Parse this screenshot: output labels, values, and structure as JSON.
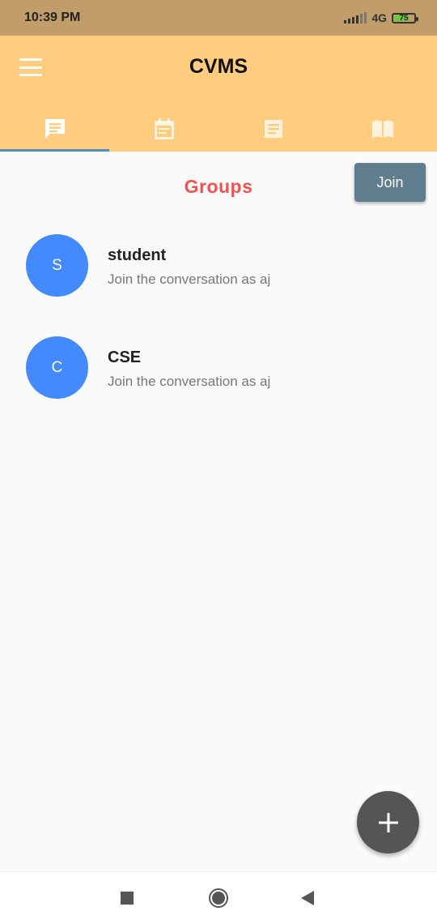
{
  "status_bar": {
    "time": "10:39 PM",
    "network": "4G",
    "battery": "75",
    "battery_level": 0.75,
    "icons": [
      "signal-icon",
      "battery-icon"
    ]
  },
  "app_bar": {
    "title": "CVMS",
    "menu_icon": "hamburger-menu-icon",
    "color": "#ffcc80"
  },
  "tabs": [
    {
      "icon": "chat-icon",
      "selected": true
    },
    {
      "icon": "calendar-icon",
      "selected": false
    },
    {
      "icon": "notes-icon",
      "selected": false
    },
    {
      "icon": "book-icon",
      "selected": false
    }
  ],
  "main": {
    "title": "Groups",
    "join_label": "Join",
    "groups": [
      {
        "initial": "S",
        "name": "student",
        "subtitle": "Join the conversation as aj"
      },
      {
        "initial": "C",
        "name": "CSE",
        "subtitle": "Join the conversation as aj"
      }
    ]
  },
  "fab": {
    "icon": "plus-icon"
  },
  "nav_bar": {
    "icons": [
      "recents-icon",
      "home-icon",
      "back-icon"
    ]
  },
  "colors": {
    "accent": "#4a90c8",
    "title_red": "#ef5350",
    "avatar_blue": "#448aff",
    "join_button": "#5f7d8c",
    "fab": "#555555"
  }
}
